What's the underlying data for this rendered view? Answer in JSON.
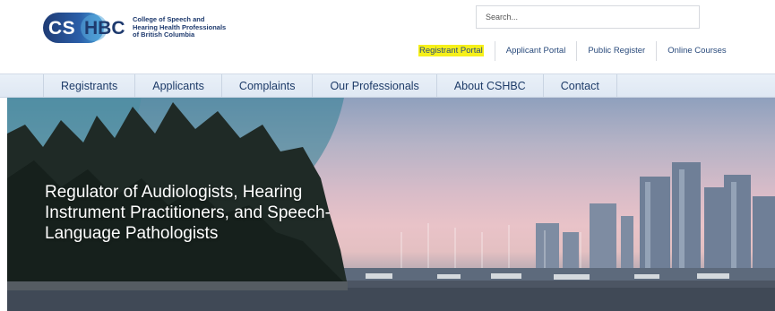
{
  "logo": {
    "mark_left": "CS",
    "mark_right": "HBC",
    "lines": [
      "College of Speech and",
      "Hearing Health Professionals",
      "of British Columbia"
    ]
  },
  "search": {
    "placeholder": "Search..."
  },
  "utility_nav": [
    {
      "label": "Registrant Portal",
      "highlighted": true
    },
    {
      "label": "Applicant Portal",
      "highlighted": false
    },
    {
      "label": "Public Register",
      "highlighted": false
    },
    {
      "label": "Online Courses",
      "highlighted": false
    }
  ],
  "main_nav": [
    "Registrants",
    "Applicants",
    "Complaints",
    "Our Professionals",
    "About CSHBC",
    "Contact"
  ],
  "hero": {
    "lines": [
      "Regulator of Audiologists, Hearing",
      "Instrument Practitioners, and Speech-",
      "Language Pathologists"
    ]
  },
  "colors": {
    "brand_navy": "#1e3a6e",
    "link_blue": "#2a4b7c",
    "highlight": "#f6f01a",
    "nav_bg": "#e4ecf5"
  }
}
